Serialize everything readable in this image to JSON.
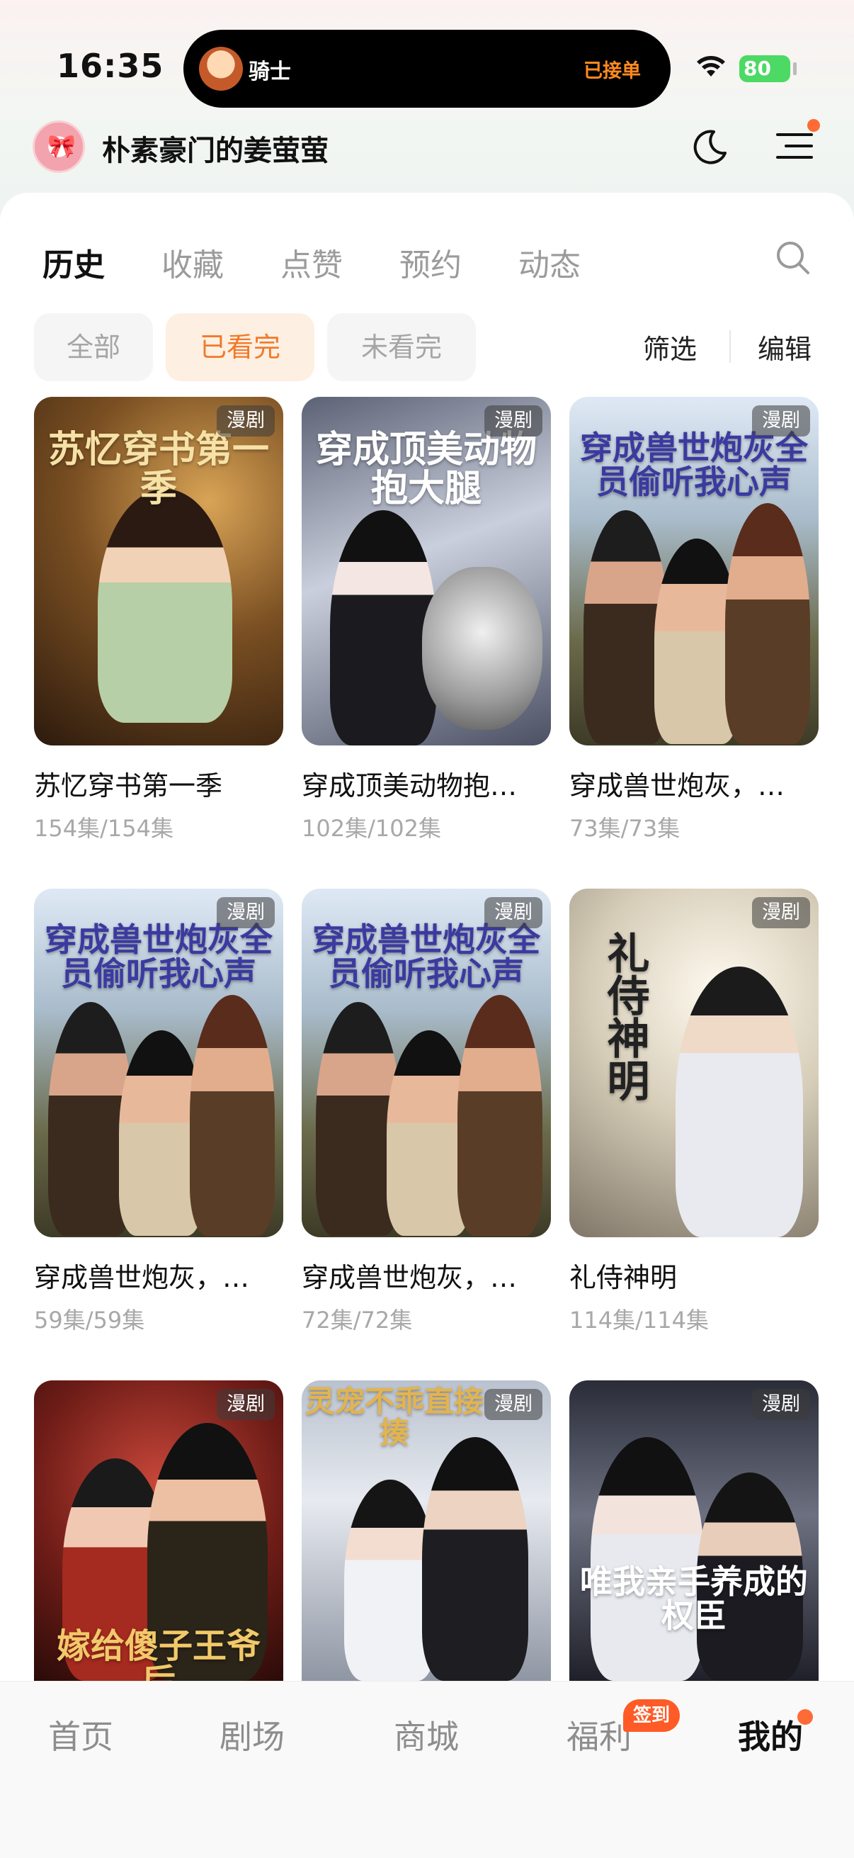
{
  "status_bar": {
    "time": "16:35",
    "island_name": "骑士",
    "island_status": "已接单",
    "battery": "80"
  },
  "header": {
    "avatar_glyph": "🎀",
    "user_name": "朴素豪门的姜萤萤"
  },
  "tabs": [
    "历史",
    "收藏",
    "点赞",
    "预约",
    "动态"
  ],
  "filters": [
    "全部",
    "已看完",
    "未看完"
  ],
  "filter_actions": {
    "filter": "筛选",
    "edit": "编辑"
  },
  "badge_label": "漫剧",
  "items": [
    {
      "title": "苏忆穿书第一季",
      "count": "154集/154集",
      "cover_text": "苏忆穿书第一季"
    },
    {
      "title": "穿成顶美动物抱…",
      "count": "102集/102集",
      "cover_text": "穿成顶美动物抱大腿"
    },
    {
      "title": "穿成兽世炮灰，…",
      "count": "73集/73集",
      "cover_text": "穿成兽世炮灰全员偷听我心声"
    },
    {
      "title": "穿成兽世炮灰，…",
      "count": "59集/59集",
      "cover_text": "穿成兽世炮灰全员偷听我心声"
    },
    {
      "title": "穿成兽世炮灰，…",
      "count": "72集/72集",
      "cover_text": "穿成兽世炮灰全员偷听我心声"
    },
    {
      "title": "礼侍神明",
      "count": "114集/114集",
      "cover_text": "礼侍神明"
    },
    {
      "title": "",
      "count": "",
      "cover_text": "嫁给傻子王爷后"
    },
    {
      "title": "",
      "count": "",
      "cover_text": "灵宠不乖直接揍"
    },
    {
      "title": "",
      "count": "",
      "cover_text": "唯我亲手养成的权臣"
    }
  ],
  "bottom_nav": [
    "首页",
    "剧场",
    "商城",
    "福利",
    "我的"
  ],
  "nav_badge": "签到",
  "colors": {
    "accent": "#f07a2a",
    "badge": "#ff5b26",
    "battery": "#4cd964"
  }
}
